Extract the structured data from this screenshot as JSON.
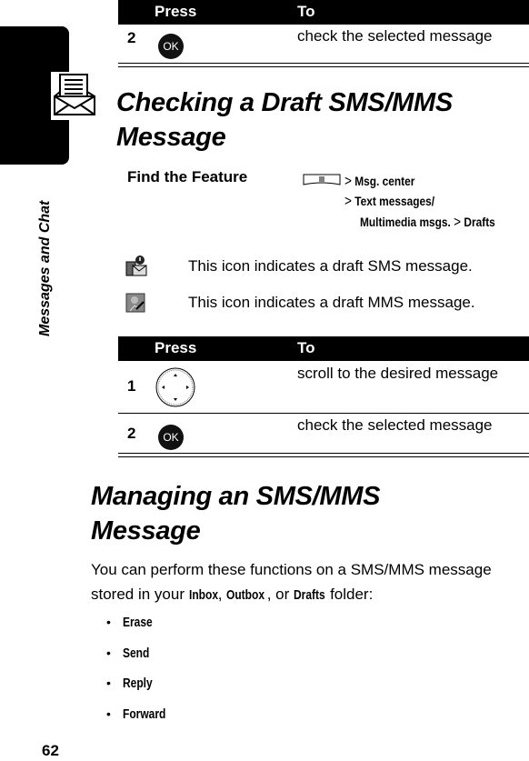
{
  "side_tab": {
    "label": "Messages and Chat",
    "icon": "envelope-letter-icon"
  },
  "top_table": {
    "header": {
      "press": "Press",
      "to": "To"
    },
    "rows": [
      {
        "num": "2",
        "key": "OK",
        "key_icon": "ok-button-icon",
        "action": "check the selected message"
      }
    ]
  },
  "section1": {
    "title_line1": "Checking a Draft SMS/MMS",
    "title_line2": "Message",
    "find_feature": {
      "label": "Find the Feature",
      "menu_icon": "menu-key-icon",
      "path": [
        "Msg. center",
        "Text messages/",
        "Multimedia msgs.",
        "Drafts"
      ],
      "separator": ">"
    },
    "icons": [
      {
        "icon": "draft-sms-icon",
        "text": "This icon indicates a draft SMS message."
      },
      {
        "icon": "draft-mms-icon",
        "text": "This icon indicates a draft MMS message."
      }
    ],
    "table": {
      "header": {
        "press": "Press",
        "to": "To"
      },
      "rows": [
        {
          "num": "1",
          "key_icon": "navigation-key-icon",
          "action": "scroll to the desired message"
        },
        {
          "num": "2",
          "key": "OK",
          "key_icon": "ok-button-icon",
          "action": "check the selected message"
        }
      ]
    }
  },
  "section2": {
    "title_line1": "Managing an SMS/MMS",
    "title_line2": "Message",
    "body_before": "You can perform these functions on a SMS/MMS message stored in your ",
    "folders": [
      "Inbox",
      "Outbox",
      "Drafts"
    ],
    "sep1": ", ",
    "sep2": ", or ",
    "body_after": " folder:",
    "bullet": "•",
    "functions": [
      "Erase",
      "Send",
      "Reply",
      "Forward"
    ]
  },
  "page_number": "62"
}
